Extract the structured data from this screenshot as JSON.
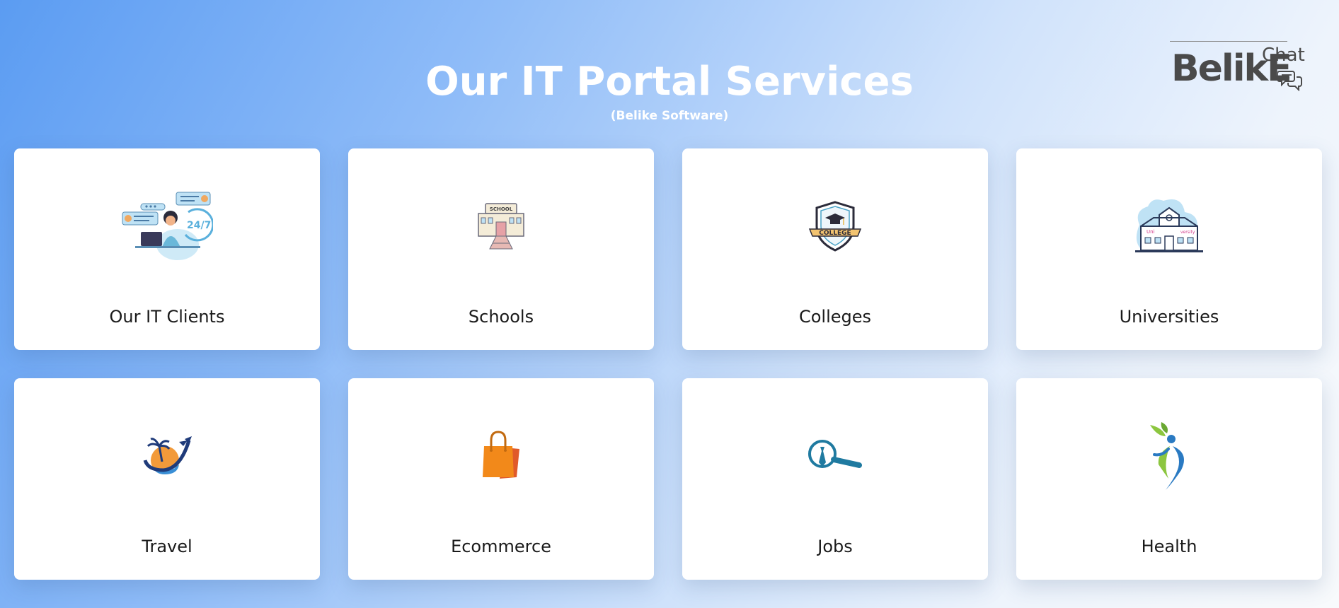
{
  "header": {
    "title": "Our IT Portal Services",
    "subtitle": "(Belike Software)"
  },
  "logo": {
    "main": "BelikE",
    "sub": "Chat"
  },
  "cards": [
    {
      "label": "Our IT Clients",
      "icon": "support-agent-icon"
    },
    {
      "label": "Schools",
      "icon": "school-building-icon"
    },
    {
      "label": "Colleges",
      "icon": "college-shield-icon"
    },
    {
      "label": "Universities",
      "icon": "university-building-icon"
    },
    {
      "label": "Travel",
      "icon": "travel-globe-icon"
    },
    {
      "label": "Ecommerce",
      "icon": "shopping-bag-icon"
    },
    {
      "label": "Jobs",
      "icon": "job-search-icon"
    },
    {
      "label": "Health",
      "icon": "health-figure-icon"
    }
  ],
  "colors": {
    "background_start": "#5b9cf2",
    "background_end": "#f8fafc",
    "card_background": "#ffffff",
    "title_color": "#ffffff"
  }
}
